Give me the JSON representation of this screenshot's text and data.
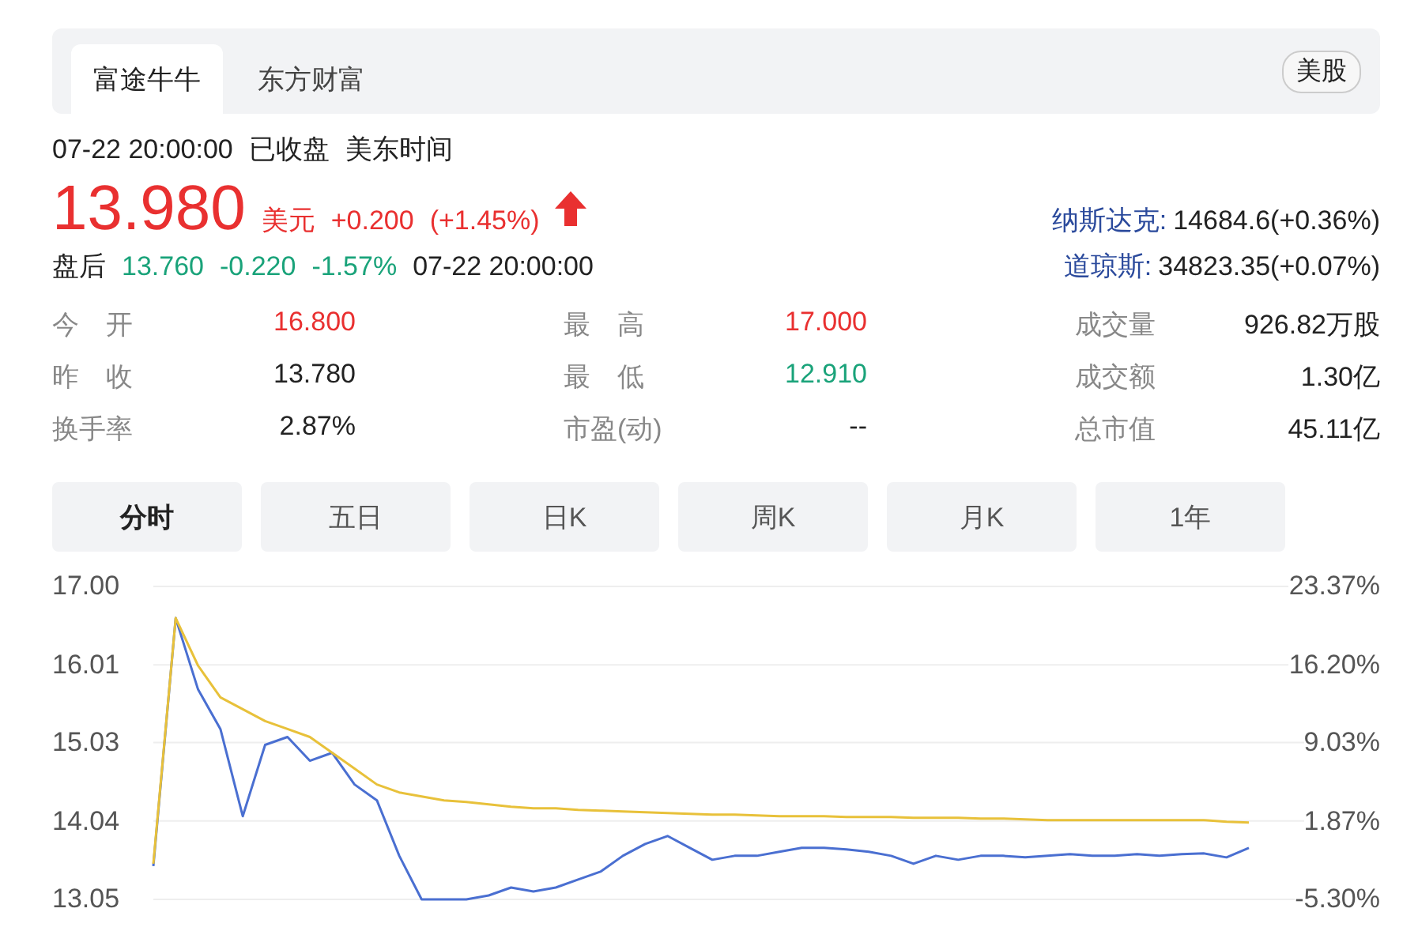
{
  "source_tabs": [
    {
      "label": "富途牛牛",
      "selected": true
    },
    {
      "label": "东方财富",
      "selected": false
    }
  ],
  "market_badge": "美股",
  "status": {
    "datetime": "07-22 20:00:00",
    "state": "已收盘",
    "timezone": "美东时间"
  },
  "quote": {
    "price": "13.980",
    "currency": "美元",
    "change": "+0.200",
    "change_pct": "(+1.45%)"
  },
  "after_hours": {
    "label": "盘后",
    "price": "13.760",
    "change": "-0.220",
    "change_pct": "-1.57%",
    "time": "07-22 20:00:00"
  },
  "indices": [
    {
      "name": "纳斯达克:",
      "value": "14684.6(+0.36%)"
    },
    {
      "name": "道琼斯:",
      "value": "34823.35(+0.07%)"
    }
  ],
  "stats": [
    {
      "label": "今　开",
      "value": "16.800",
      "color": "#e93030"
    },
    {
      "label": "最　高",
      "value": "17.000",
      "color": "#e93030"
    },
    {
      "label": "成交量",
      "value": "926.82万股",
      "color": "#222222"
    },
    {
      "label": "昨　收",
      "value": "13.780",
      "color": "#222222"
    },
    {
      "label": "最　低",
      "value": "12.910",
      "color": "#1aa37a"
    },
    {
      "label": "成交额",
      "value": "1.30亿",
      "color": "#222222"
    },
    {
      "label": "换手率",
      "value": "2.87%",
      "color": "#222222"
    },
    {
      "label": "市盈(动)",
      "value": "--",
      "color": "#222222"
    },
    {
      "label": "总市值",
      "value": "45.11亿",
      "color": "#222222"
    }
  ],
  "periods": [
    {
      "label": "分时",
      "selected": true
    },
    {
      "label": "五日",
      "selected": false
    },
    {
      "label": "日K",
      "selected": false
    },
    {
      "label": "周K",
      "selected": false
    },
    {
      "label": "月K",
      "selected": false
    },
    {
      "label": "1年",
      "selected": false
    }
  ],
  "chart": {
    "right_axis_labels": [
      "23.37%",
      "16.20%",
      "9.03%",
      "1.87%",
      "-5.30%"
    ],
    "chart_data": {
      "type": "line",
      "grid": true,
      "ylim": [
        13.05,
        17.0
      ],
      "yticks": [
        {
          "value": 17.0,
          "label": "17.00"
        },
        {
          "value": 16.01,
          "label": "16.01"
        },
        {
          "value": 15.03,
          "label": "15.03"
        },
        {
          "value": 14.04,
          "label": "14.04"
        },
        {
          "value": 13.05,
          "label": "13.05"
        }
      ],
      "series": [
        {
          "color": "#4a6fd1",
          "values": [
            13.47,
            16.6,
            15.7,
            15.2,
            14.1,
            15.0,
            15.1,
            14.8,
            14.9,
            14.5,
            14.3,
            13.6,
            13.05,
            13.05,
            13.05,
            13.1,
            13.2,
            13.15,
            13.2,
            13.3,
            13.4,
            13.6,
            13.75,
            13.85,
            13.7,
            13.55,
            13.6,
            13.6,
            13.65,
            13.7,
            13.7,
            13.68,
            13.65,
            13.6,
            13.5,
            13.6,
            13.55,
            13.6,
            13.6,
            13.58,
            13.6,
            13.62,
            13.6,
            13.6,
            13.62,
            13.6,
            13.62,
            13.63,
            13.58,
            13.7
          ]
        },
        {
          "color": "#e8c13a",
          "values": [
            13.5,
            16.6,
            16.0,
            15.6,
            15.45,
            15.3,
            15.2,
            15.1,
            14.9,
            14.7,
            14.5,
            14.4,
            14.35,
            14.3,
            14.28,
            14.25,
            14.22,
            14.2,
            14.2,
            14.18,
            14.17,
            14.16,
            14.15,
            14.14,
            14.13,
            14.12,
            14.12,
            14.11,
            14.1,
            14.1,
            14.1,
            14.09,
            14.09,
            14.09,
            14.08,
            14.08,
            14.08,
            14.07,
            14.07,
            14.06,
            14.05,
            14.05,
            14.05,
            14.05,
            14.05,
            14.05,
            14.05,
            14.05,
            14.03,
            14.02
          ]
        }
      ]
    }
  }
}
